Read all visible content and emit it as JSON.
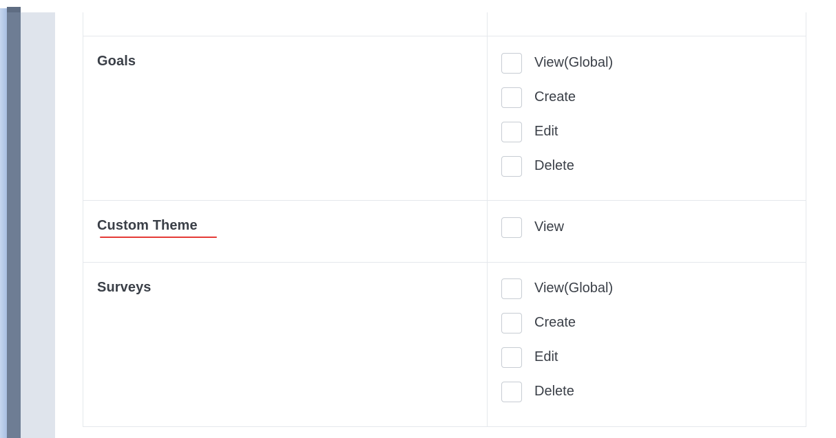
{
  "colors": {
    "border": "#e5e8ec",
    "text": "#3a3f47",
    "checkbox_border": "#c7ccd3",
    "spell_underline": "#e53935",
    "sidebar": "#6e7d94"
  },
  "permissions_table": {
    "rows": [
      {
        "module": "Goals",
        "permissions": [
          "View(Global)",
          "Create",
          "Edit",
          "Delete"
        ]
      },
      {
        "module": "Custom Theme",
        "permissions": [
          "View"
        ]
      },
      {
        "module": "Surveys",
        "permissions": [
          "View(Global)",
          "Create",
          "Edit",
          "Delete"
        ]
      }
    ]
  }
}
